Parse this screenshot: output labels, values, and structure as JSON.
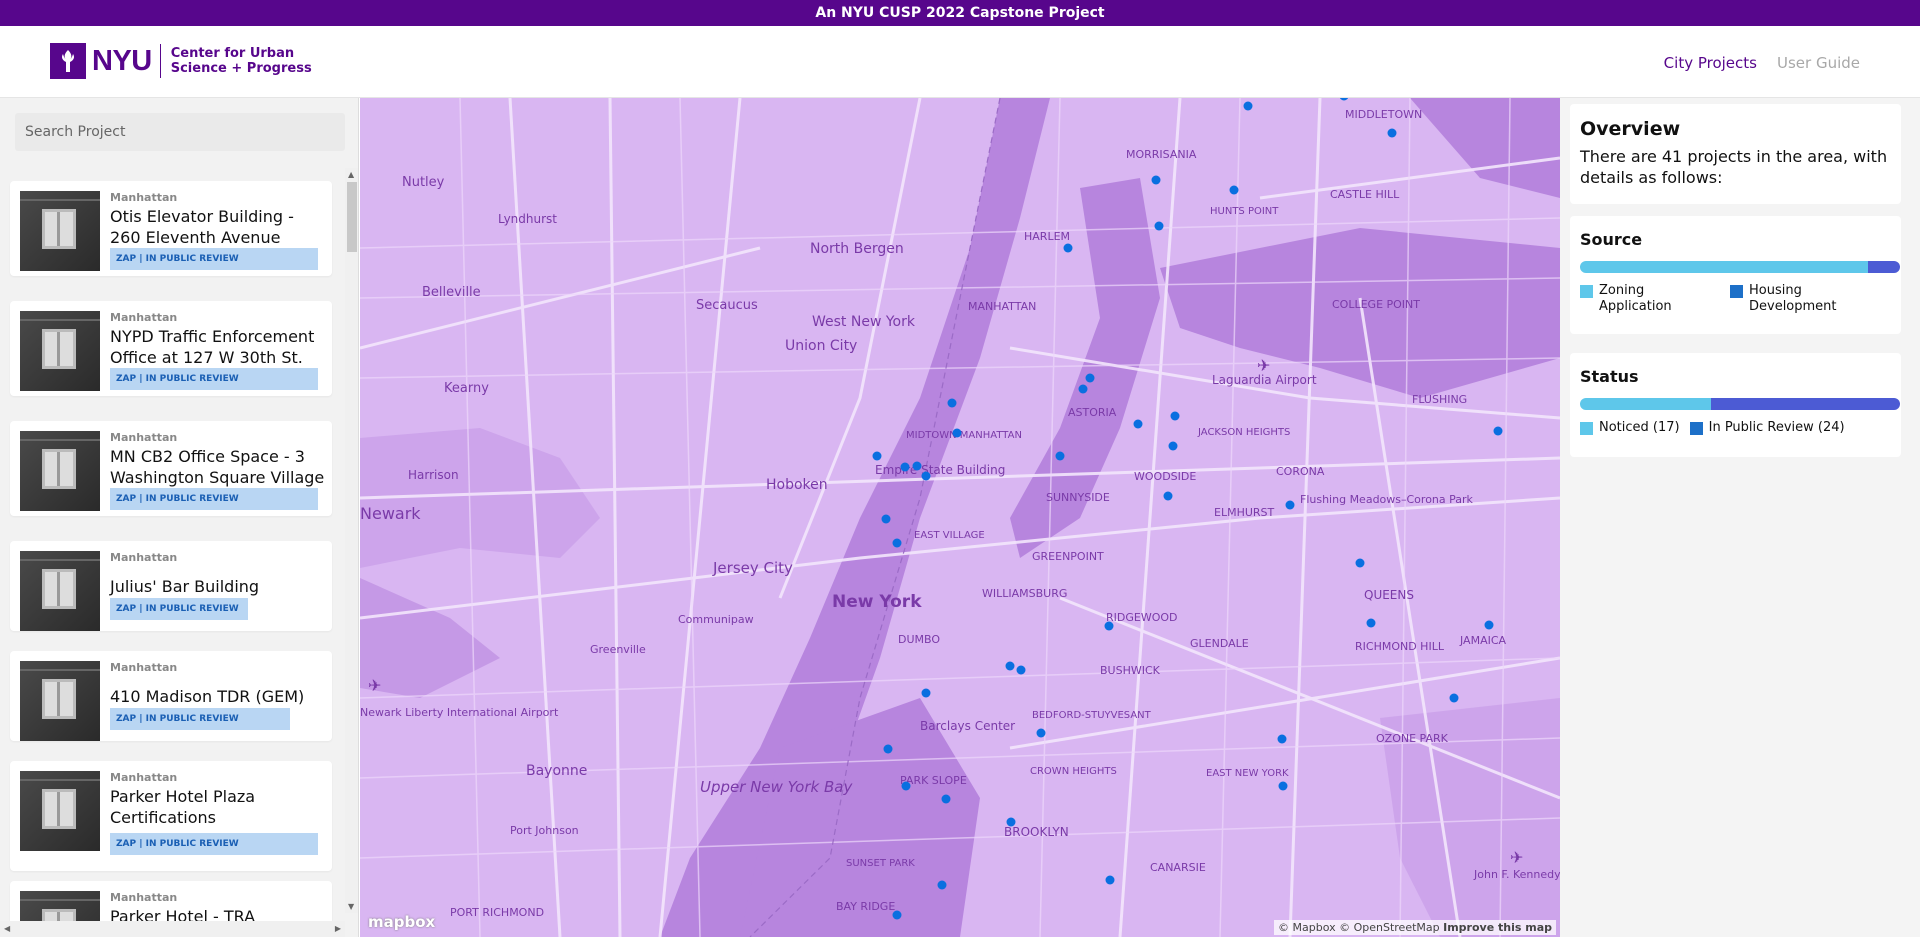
{
  "banner": {
    "text": "An NYU CUSP 2022 Capstone Project"
  },
  "header": {
    "logo_text": "NYU",
    "logo_sub_line1": "Center for Urban",
    "logo_sub_line2": "Science + Progress",
    "nav": [
      {
        "label": "City Projects",
        "active": true
      },
      {
        "label": "User Guide",
        "active": false
      }
    ]
  },
  "sidebar": {
    "search_placeholder": "Search Project",
    "projects": [
      {
        "borough": "Manhattan",
        "title": "Otis Elevator Building - 260 Eleventh Avenue",
        "badge": "ZAP | IN PUBLIC REVIEW"
      },
      {
        "borough": "Manhattan",
        "title": "NYPD Traffic Enforcement Office at 127 W 30th St.",
        "badge": "ZAP | IN PUBLIC REVIEW"
      },
      {
        "borough": "Manhattan",
        "title": "MN CB2 Office Space - 3 Washington Square Village",
        "badge": "ZAP | IN PUBLIC REVIEW"
      },
      {
        "borough": "Manhattan",
        "title": "Julius' Bar Building",
        "badge": "ZAP | IN PUBLIC REVIEW"
      },
      {
        "borough": "Manhattan",
        "title": "410 Madison TDR (GEM)",
        "badge": "ZAP | IN PUBLIC REVIEW"
      },
      {
        "borough": "Manhattan",
        "title": "Parker Hotel Plaza Certifications",
        "badge": "ZAP | IN PUBLIC REVIEW"
      },
      {
        "borough": "Manhattan",
        "title": "Parker Hotel - TRA",
        "badge": ""
      }
    ]
  },
  "map": {
    "labels": {
      "newark": "Newark",
      "nutley": "Nutley",
      "belleville": "Belleville",
      "kearny": "Kearny",
      "harrison": "Harrison",
      "lyndhurst": "Lyndhurst",
      "secaucus": "Secaucus",
      "north_bergen": "North Bergen",
      "union_city": "Union City",
      "west_new_york": "West New York",
      "hoboken": "Hoboken",
      "jersey_city": "Jersey City",
      "new_york": "New York",
      "bayonne": "Bayonne",
      "upper_bay": "Upper New York Bay",
      "harlem": "HARLEM",
      "manhattan": "MANHATTAN",
      "midtown": "MIDTOWN MANHATTAN",
      "empire": "Empire State Building",
      "east_village": "EAST VILLAGE",
      "williamsburg": "WILLIAMSBURG",
      "greenpoint": "GREENPOINT",
      "sunnyside": "SUNNYSIDE",
      "woodside": "WOODSIDE",
      "astoria": "ASTORIA",
      "laguardia": "Laguardia Airport",
      "flushing": "FLUSHING",
      "corona": "CORONA",
      "elmhurst": "ELMHURST",
      "flushing_meadows": "Flushing Meadows–Corona Park",
      "queens": "QUEENS",
      "jamaica": "JAMAICA",
      "ridgewood": "RIDGEWOOD",
      "bushwick": "BUSHWICK",
      "bed_stuy": "BEDFORD-STUYVESANT",
      "barclays": "Barclays Center",
      "park_slope": "PARK SLOPE",
      "crown_heights": "CROWN HEIGHTS",
      "brooklyn": "BROOKLYN",
      "east_new_york": "EAST NEW YORK",
      "canarsie": "CANARSIE",
      "sunset_park": "SUNSET PARK",
      "bay_ridge": "BAY RIDGE",
      "morrisania": "MORRISANIA",
      "hunts_point": "HUNTS POINT",
      "castle_hill": "CASTLE HILL",
      "jfk": "John F. Kennedy International Airport",
      "newark_airport": "Newark Liberty International Airport",
      "dumbo": "DUMBO",
      "jackson_heights": "JACKSON HEIGHTS",
      "ozone_park": "OZONE PARK",
      "richmond_hill": "RICHMOND HILL",
      "glendale": "GLENDALE",
      "middletown": "MIDDLETOWN",
      "college_point": "COLLEGE POINT",
      "port_richmond": "PORT RICHMOND",
      "port_johnson": "Port Johnson",
      "communipaw": "Communipaw",
      "greenville": "Greenville"
    },
    "attribution": "© Mapbox © OpenStreetMap",
    "improve": "Improve this map",
    "mapbox_logo": "mapbox"
  },
  "overview": {
    "title": "Overview",
    "text": "There are 41 projects in the area, with details as follows:",
    "source": {
      "title": "Source",
      "segments": [
        {
          "label": "Zoning Application",
          "share": 0.9,
          "color": "#5ec7ea"
        },
        {
          "label": "Housing Development",
          "share": 0.1,
          "color": "#4c5bd4"
        }
      ],
      "legend": [
        {
          "label": "Zoning Application",
          "color": "#5ec7ea"
        },
        {
          "label": "Housing Development",
          "color": "#1d70c8"
        }
      ]
    },
    "status": {
      "title": "Status",
      "segments": [
        {
          "label": "Noticed (17)",
          "share": 0.41,
          "color": "#5ec7ea"
        },
        {
          "label": "In Public Review (24)",
          "share": 0.59,
          "color": "#4c5bd4"
        }
      ],
      "legend": [
        {
          "label": "Noticed (17)",
          "color": "#5ec7ea"
        },
        {
          "label": "In Public Review (24)",
          "color": "#1d70c8"
        }
      ]
    }
  },
  "colors": {
    "brand": "#57068c",
    "point": "#0a6fe0",
    "map_land": "#d9b6f2",
    "map_water": "#b785de"
  }
}
